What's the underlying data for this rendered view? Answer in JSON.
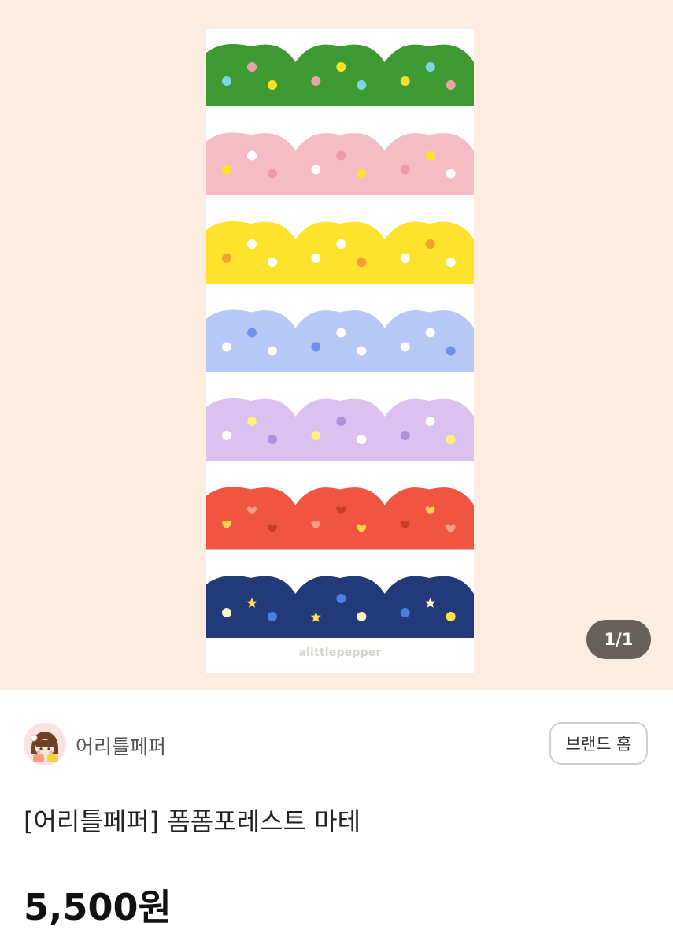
{
  "product_image": {
    "counter": "1/1",
    "sheet_brand_text": "alittlepepper",
    "strips": [
      {
        "band": "#3f9932",
        "dots": [
          "#7fd6e8",
          "#e8a4a4",
          "#ffe02a"
        ],
        "shape": "dot"
      },
      {
        "band": "#f6bcc6",
        "dots": [
          "#ffe02a",
          "#ffffff",
          "#ec9aa8"
        ],
        "shape": "dot"
      },
      {
        "band": "#ffe22c",
        "dots": [
          "#f2a22e",
          "#ffffff",
          "#ffffff"
        ],
        "shape": "dot"
      },
      {
        "band": "#b6c8f6",
        "dots": [
          "#ffffff",
          "#6f8ff0",
          "#ffffff"
        ],
        "shape": "dot"
      },
      {
        "band": "#dcc0ef",
        "dots": [
          "#ffffff",
          "#fff07a",
          "#b18fd6"
        ],
        "shape": "dot"
      },
      {
        "band": "#ef5540",
        "dots": [
          "#ffd24a",
          "#f59d82",
          "#c93d2e"
        ],
        "shape": "heart"
      },
      {
        "band": "#233a7a",
        "dots": [
          "#fff7c8",
          "#ffe04a",
          "#4f7de2"
        ],
        "shape": "star"
      }
    ]
  },
  "brand": {
    "avatar_icon": "brand-avatar",
    "name": "어리틀페퍼",
    "home_button": "브랜드 홈"
  },
  "product": {
    "title": "[어리틀페퍼] 폼폼포레스트 마테",
    "price": "5,500원"
  }
}
